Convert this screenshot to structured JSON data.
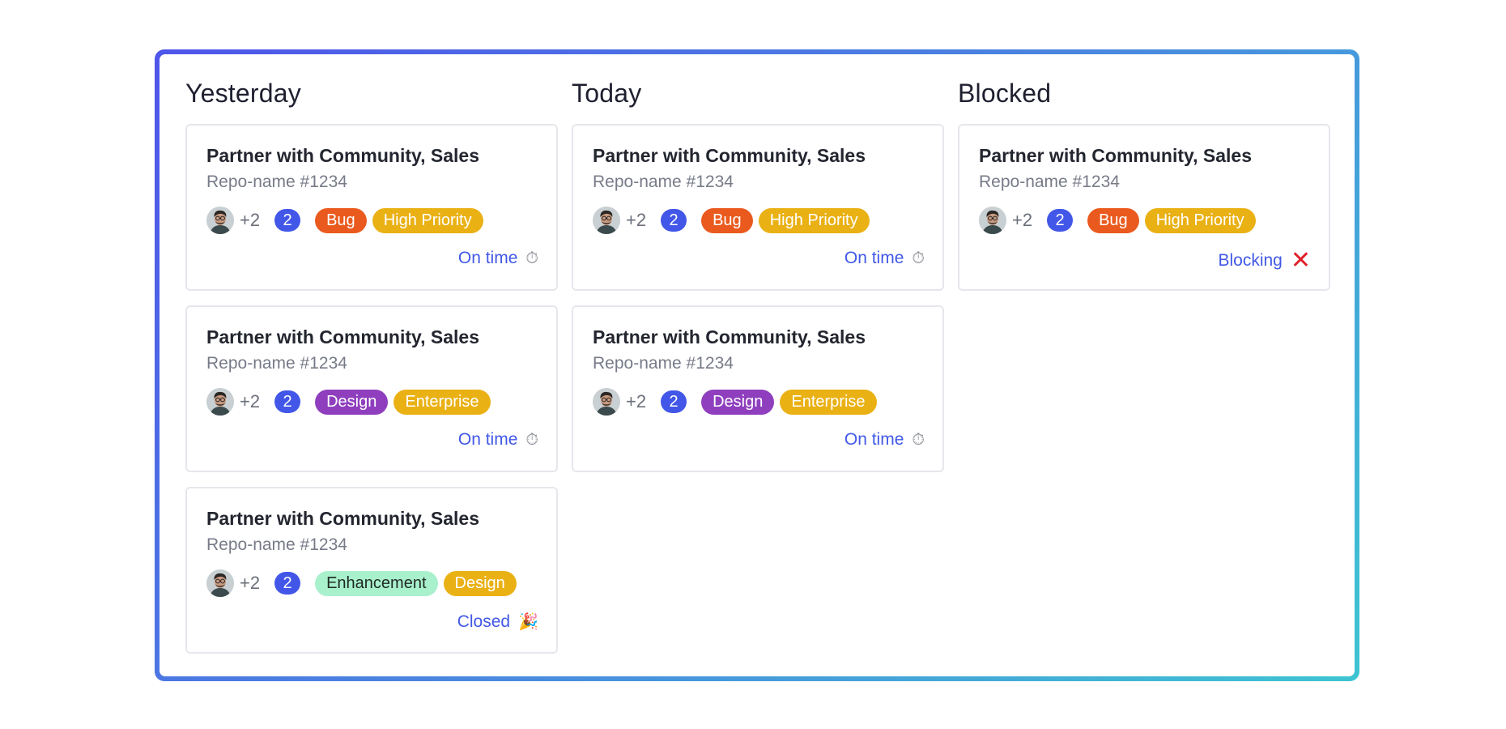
{
  "columns": [
    {
      "title": "Yesterday",
      "cards": [
        {
          "title": "Partner with Community, Sales",
          "repo": "Repo-name #1234",
          "extra": "+2",
          "count": "2",
          "tags": [
            {
              "label": "Bug",
              "color": "#ea5a1e",
              "text": "#ffffff"
            },
            {
              "label": "High Priority",
              "color": "#eab115",
              "text": "#ffffff"
            }
          ],
          "status": "On time",
          "status_icon": "stopwatch-icon"
        },
        {
          "title": "Partner with Community, Sales",
          "repo": "Repo-name #1234",
          "extra": "+2",
          "count": "2",
          "tags": [
            {
              "label": "Design",
              "color": "#8f3fbe",
              "text": "#ffffff"
            },
            {
              "label": "Enterprise",
              "color": "#eab115",
              "text": "#ffffff"
            }
          ],
          "status": "On time",
          "status_icon": "stopwatch-icon"
        },
        {
          "title": "Partner with Community, Sales",
          "repo": "Repo-name #1234",
          "extra": "+2",
          "count": "2",
          "tags": [
            {
              "label": "Enhancement",
              "color": "#a9f0cd",
              "text": "#1f2a22"
            },
            {
              "label": "Design",
              "color": "#eab115",
              "text": "#ffffff"
            }
          ],
          "status": "Closed",
          "status_icon": "party-popper-icon"
        }
      ]
    },
    {
      "title": "Today",
      "cards": [
        {
          "title": "Partner with Community, Sales",
          "repo": "Repo-name #1234",
          "extra": "+2",
          "count": "2",
          "tags": [
            {
              "label": "Bug",
              "color": "#ea5a1e",
              "text": "#ffffff"
            },
            {
              "label": "High Priority",
              "color": "#eab115",
              "text": "#ffffff"
            }
          ],
          "status": "On time",
          "status_icon": "stopwatch-icon"
        },
        {
          "title": "Partner with Community, Sales",
          "repo": "Repo-name #1234",
          "extra": "+2",
          "count": "2",
          "tags": [
            {
              "label": "Design",
              "color": "#8f3fbe",
              "text": "#ffffff"
            },
            {
              "label": "Enterprise",
              "color": "#eab115",
              "text": "#ffffff"
            }
          ],
          "status": "On time",
          "status_icon": "stopwatch-icon"
        }
      ]
    },
    {
      "title": "Blocked",
      "cards": [
        {
          "title": "Partner with Community, Sales",
          "repo": "Repo-name #1234",
          "extra": "+2",
          "count": "2",
          "tags": [
            {
              "label": "Bug",
              "color": "#ea5a1e",
              "text": "#ffffff"
            },
            {
              "label": "High Priority",
              "color": "#eab115",
              "text": "#ffffff"
            }
          ],
          "status": "Blocking",
          "status_icon": "close-x-icon"
        }
      ]
    }
  ],
  "colors": {
    "frame_start": "#4f55ea",
    "frame_end": "#3ec4d2",
    "link": "#4158e6",
    "count_badge": "#4257e8",
    "blocking_x": "#e0202a"
  }
}
